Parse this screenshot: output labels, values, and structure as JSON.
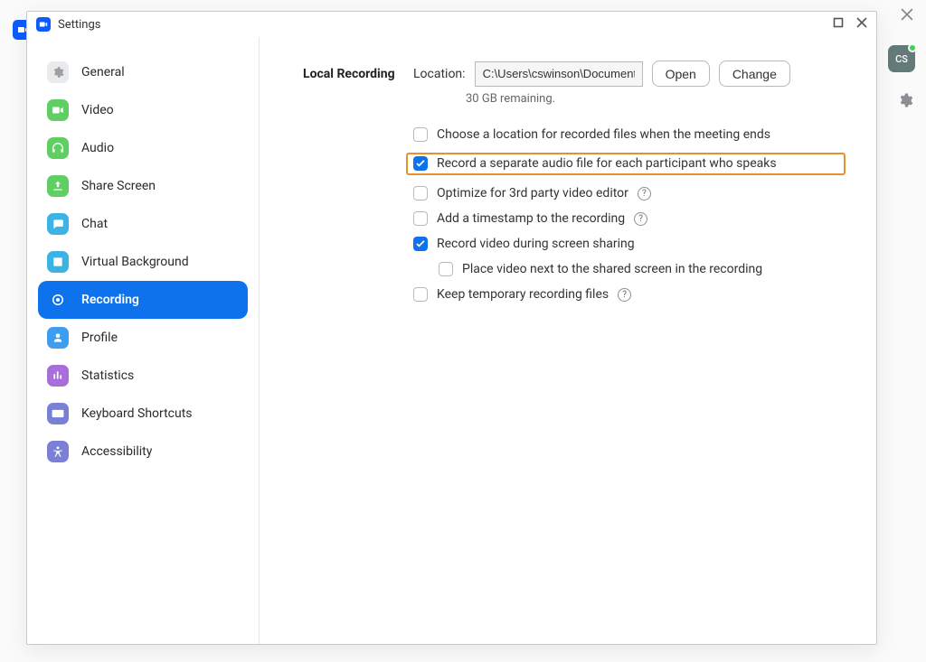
{
  "window": {
    "title": "Settings"
  },
  "avatar": {
    "initials": "CS"
  },
  "sidebar": {
    "items": [
      {
        "id": "general",
        "label": "General"
      },
      {
        "id": "video",
        "label": "Video"
      },
      {
        "id": "audio",
        "label": "Audio"
      },
      {
        "id": "share-screen",
        "label": "Share Screen"
      },
      {
        "id": "chat",
        "label": "Chat"
      },
      {
        "id": "virtual-background",
        "label": "Virtual Background"
      },
      {
        "id": "recording",
        "label": "Recording"
      },
      {
        "id": "profile",
        "label": "Profile"
      },
      {
        "id": "statistics",
        "label": "Statistics"
      },
      {
        "id": "keyboard-shortcuts",
        "label": "Keyboard Shortcuts"
      },
      {
        "id": "accessibility",
        "label": "Accessibility"
      }
    ],
    "active": "recording"
  },
  "recording": {
    "section_title": "Local Recording",
    "location_label": "Location:",
    "location_value": "C:\\Users\\cswinson\\Documents\\Z",
    "open_btn": "Open",
    "change_btn": "Change",
    "remaining": "30 GB remaining.",
    "options": [
      {
        "id": "choose-location-end",
        "label": "Choose a location for recorded files when the meeting ends",
        "checked": false,
        "help": false,
        "highlight": false
      },
      {
        "id": "separate-audio",
        "label": "Record a separate audio file for each participant who speaks",
        "checked": true,
        "help": false,
        "highlight": true
      },
      {
        "id": "optimize-3rd-party",
        "label": "Optimize for 3rd party video editor",
        "checked": false,
        "help": true,
        "highlight": false
      },
      {
        "id": "add-timestamp",
        "label": "Add a timestamp to the recording",
        "checked": false,
        "help": true,
        "highlight": false
      },
      {
        "id": "record-during-share",
        "label": "Record video during screen sharing",
        "checked": true,
        "help": false,
        "highlight": false
      },
      {
        "id": "place-next-to-share",
        "label": "Place video next to the shared screen in the recording",
        "checked": false,
        "help": false,
        "highlight": false,
        "sub": true
      },
      {
        "id": "keep-temp",
        "label": "Keep temporary recording files",
        "checked": false,
        "help": true,
        "highlight": false
      }
    ]
  },
  "icons": {
    "general": "gear",
    "video": "video",
    "audio": "headphones",
    "share-screen": "share",
    "chat": "chat",
    "virtual-background": "image",
    "recording": "record",
    "profile": "user",
    "statistics": "stats",
    "keyboard-shortcuts": "keyboard",
    "accessibility": "accessibility"
  },
  "colors": {
    "accent": "#0e72ed",
    "icon_bg": {
      "general": "#e9eaec",
      "video": "#d8f2d4",
      "audio": "#d8f2d4",
      "share-screen": "#d8f2d4",
      "chat": "#d7e9f8",
      "virtual-background": "#d7e9f8",
      "recording": "#ffffff",
      "profile": "#d7e9f8",
      "statistics": "#e9d9f4",
      "keyboard-shortcuts": "#e1e3f6",
      "accessibility": "#e1e3f6"
    },
    "icon_fill": {
      "general": "#9ba0a6",
      "video": "#58c35a",
      "audio": "#58c35a",
      "share-screen": "#58c35a",
      "chat": "#3ba7dd",
      "virtual-background": "#3ba7dd",
      "recording": "#ffffff",
      "profile": "#3ba7dd",
      "statistics": "#9a5fd0",
      "keyboard-shortcuts": "#6a72c9",
      "accessibility": "#6a72c9"
    },
    "icon_solid_bg": {
      "video": "#5fcf63",
      "audio": "#5fcf63",
      "share-screen": "#5fcf63",
      "chat": "#3bb4e3",
      "virtual-background": "#3bb4e3",
      "profile": "#3f9df0",
      "statistics": "#a86ed9",
      "keyboard-shortcuts": "#7a80d6",
      "accessibility": "#7a80d6",
      "general": "#e9eaec",
      "recording": "transparent"
    }
  }
}
